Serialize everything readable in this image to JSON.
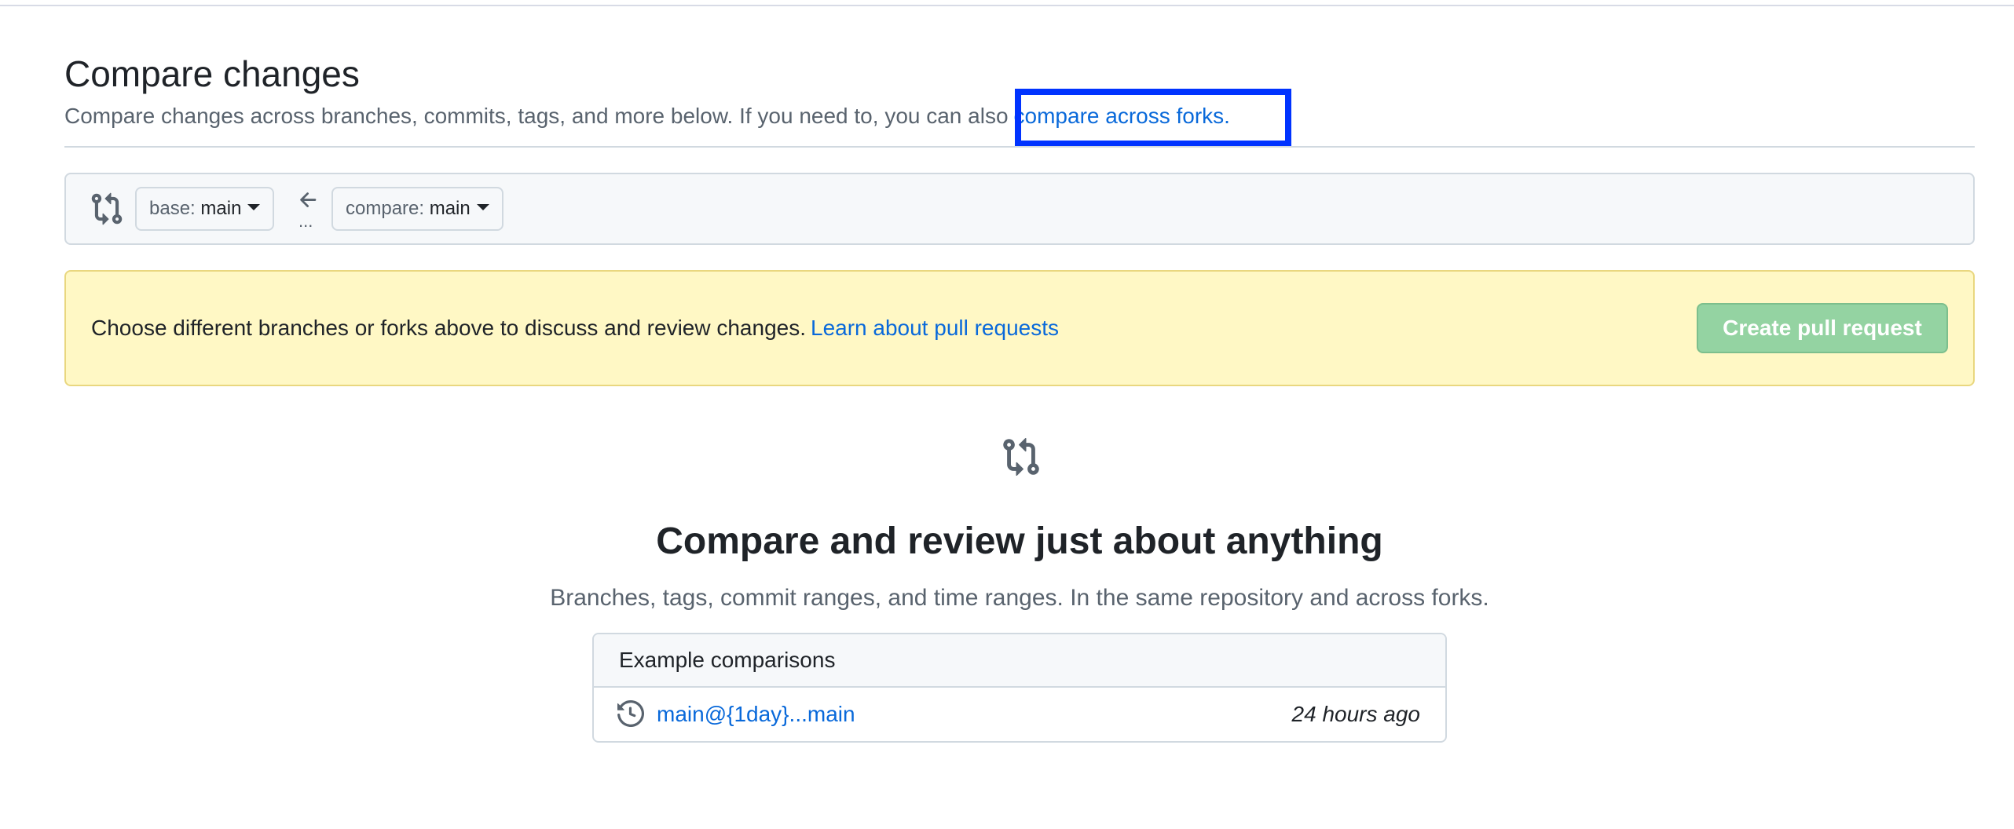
{
  "header": {
    "title": "Compare changes",
    "subtitle_prefix": "Compare changes across branches, commits, tags, and more below. If you need to, you can also",
    "fork_link": "compare across forks."
  },
  "range": {
    "base_prefix": "base:",
    "base_branch": "main",
    "compare_prefix": "compare:",
    "compare_branch": "main",
    "dots": "..."
  },
  "notice": {
    "text": "Choose different branches or forks above to discuss and review changes.",
    "link": "Learn about pull requests",
    "button": "Create pull request"
  },
  "blankslate": {
    "heading": "Compare and review just about anything",
    "subtext": "Branches, tags, commit ranges, and time ranges. In the same repository and across forks."
  },
  "examples": {
    "header": "Example comparisons",
    "items": [
      {
        "label": "main@{1day}...main",
        "time": "24 hours ago"
      }
    ]
  },
  "colors": {
    "link": "#0969da",
    "notice_bg": "#fff8c5",
    "button_disabled": "#94d3a2",
    "highlight": "#0033ff"
  },
  "icons": {
    "range": "git-compare-icon",
    "arrow": "arrow-left-icon",
    "blankslate": "git-compare-icon",
    "history": "history-icon"
  }
}
